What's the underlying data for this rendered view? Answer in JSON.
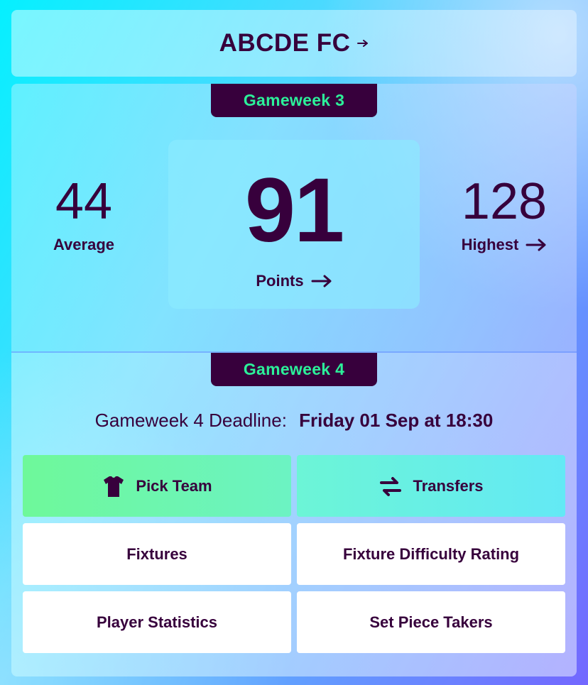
{
  "team": {
    "name": "ABCDE FC"
  },
  "current_gameweek": {
    "label": "Gameweek 3",
    "average": "44",
    "average_label": "Average",
    "points": "91",
    "points_label": "Points",
    "highest": "128",
    "highest_label": "Highest"
  },
  "next_gameweek": {
    "label": "Gameweek 4",
    "deadline_label": "Gameweek 4 Deadline:",
    "deadline_value": "Friday 01 Sep at 18:30"
  },
  "actions": {
    "pick_team": "Pick Team",
    "transfers": "Transfers",
    "fixtures": "Fixtures",
    "fdr": "Fixture Difficulty Rating",
    "player_stats": "Player Statistics",
    "set_piece": "Set Piece Takers"
  },
  "icons": {
    "shirt": "shirt-icon",
    "transfers": "swap-arrows-icon",
    "arrow": "arrow-right-icon"
  },
  "colors": {
    "primary": "#37003c",
    "accent_green": "#2cf09a",
    "button_green": "#6ef89a",
    "button_cyan": "#63e9f5"
  }
}
